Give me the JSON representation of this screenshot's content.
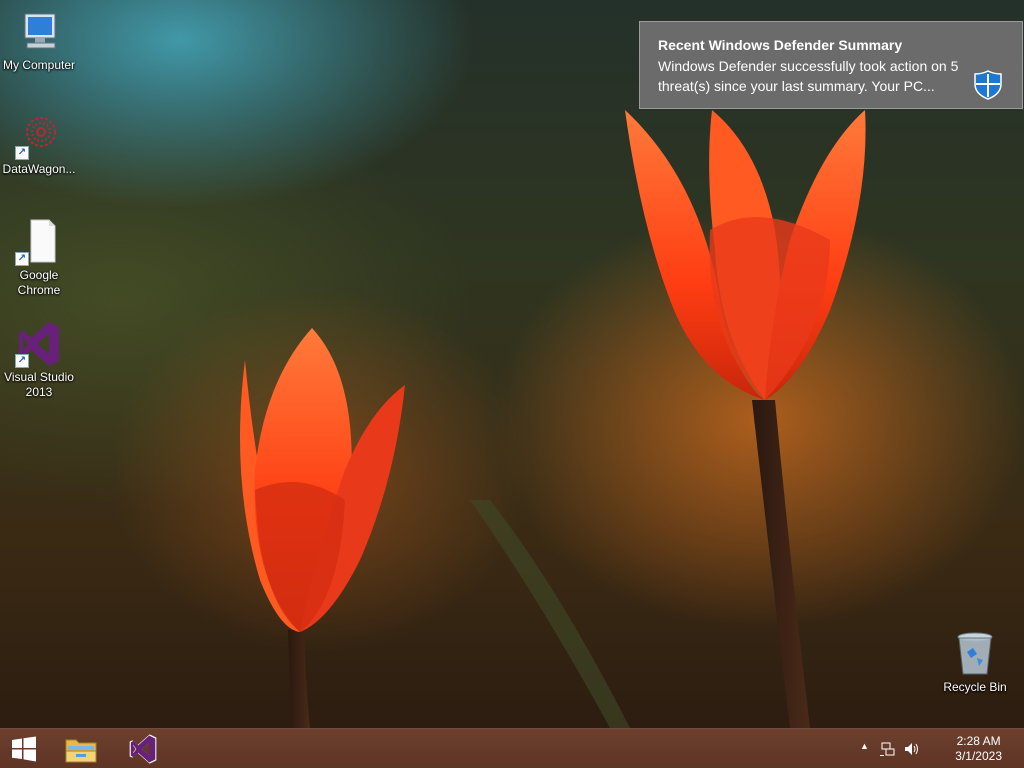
{
  "desktop": {
    "icons": [
      {
        "label": "My Computer",
        "icon": "computer-icon"
      },
      {
        "label": "DataWagon...",
        "icon": "datawagon-icon"
      },
      {
        "label": "Google Chrome",
        "icon": "chrome-icon"
      },
      {
        "label": "Visual Studio 2013",
        "icon": "visual-studio-icon"
      },
      {
        "label": "Recycle Bin",
        "icon": "recycle-bin-icon"
      }
    ]
  },
  "notification": {
    "title": "Recent Windows Defender Summary",
    "body": "Windows Defender successfully took action on 5 threat(s) since your last summary. Your PC...",
    "icon": "defender-shield-icon"
  },
  "taskbar": {
    "start": "windows-logo-icon",
    "pinned": [
      "file-explorer-icon",
      "visual-studio-icon"
    ],
    "tray": {
      "chevron": "▲",
      "time": "2:28 AM",
      "date": "3/1/2023"
    }
  },
  "colors": {
    "toast_bg": "#6b6b6b",
    "vs_purple": "#68217a",
    "tulip": "#ff4a1c"
  }
}
